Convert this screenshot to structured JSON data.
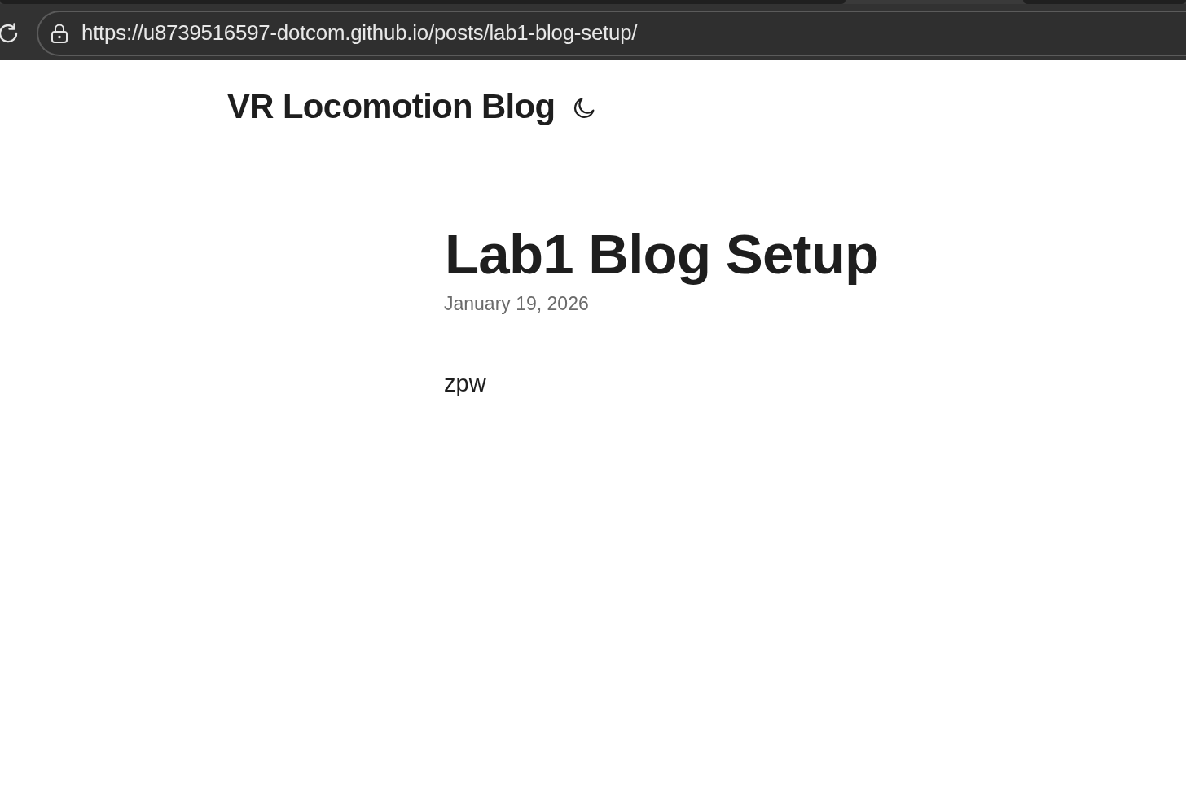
{
  "browser": {
    "url": "https://u8739516597-dotcom.github.io/posts/lab1-blog-setup/"
  },
  "site": {
    "title": "VR Locomotion Blog"
  },
  "post": {
    "title": "Lab1 Blog Setup",
    "date": "January 19, 2026",
    "body": "zpw"
  }
}
